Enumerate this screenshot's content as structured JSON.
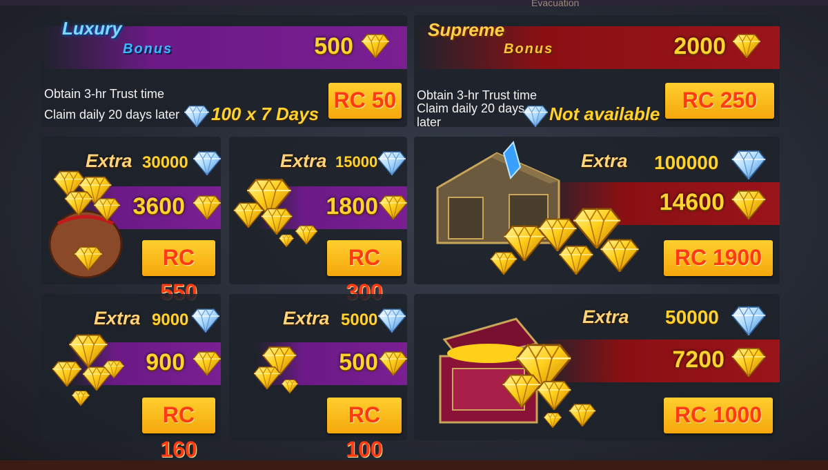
{
  "top_hint": "Evacuation",
  "colors": {
    "gold": "#ffd230",
    "button_text": "#ff3b14",
    "purple": "#7a1f93",
    "red": "#9a141a"
  },
  "bonus_packs": [
    {
      "title_line1": "Luxury",
      "title_line2": "Bonus",
      "amount": "500",
      "desc_line1": "Obtain 3-hr Trust time",
      "desc_line2": "Claim daily 20 days later",
      "offer": "100 x 7 Days",
      "price": "RC 50",
      "icon": "diamond-icon"
    },
    {
      "title_line1": "Supreme",
      "title_line2": "Bonus",
      "amount": "2000",
      "desc_line1": "Obtain 3-hr Trust time",
      "desc_line2": "Claim daily 20 days",
      "desc_line3": "later",
      "offer": "Not available",
      "price": "RC 250",
      "icon": "diamond-icon"
    }
  ],
  "packs": [
    {
      "extra_label": "Extra",
      "extra": "30000",
      "amount": "3600",
      "price": "RC 550",
      "art": "gem-sack"
    },
    {
      "extra_label": "Extra",
      "extra": "15000",
      "amount": "1800",
      "price": "RC 300",
      "art": "gem-pile"
    },
    {
      "extra_label": "Extra",
      "extra": "100000",
      "amount": "14600",
      "price": "RC 1900",
      "art": "treasure-chest-blue"
    },
    {
      "extra_label": "Extra",
      "extra": "9000",
      "amount": "900",
      "price": "RC 160",
      "art": "gem-cluster"
    },
    {
      "extra_label": "Extra",
      "extra": "5000",
      "amount": "500",
      "price": "RC 100",
      "art": "gem-small-cluster"
    },
    {
      "extra_label": "Extra",
      "extra": "50000",
      "amount": "7200",
      "price": "RC 1000",
      "art": "treasure-chest-red"
    }
  ]
}
